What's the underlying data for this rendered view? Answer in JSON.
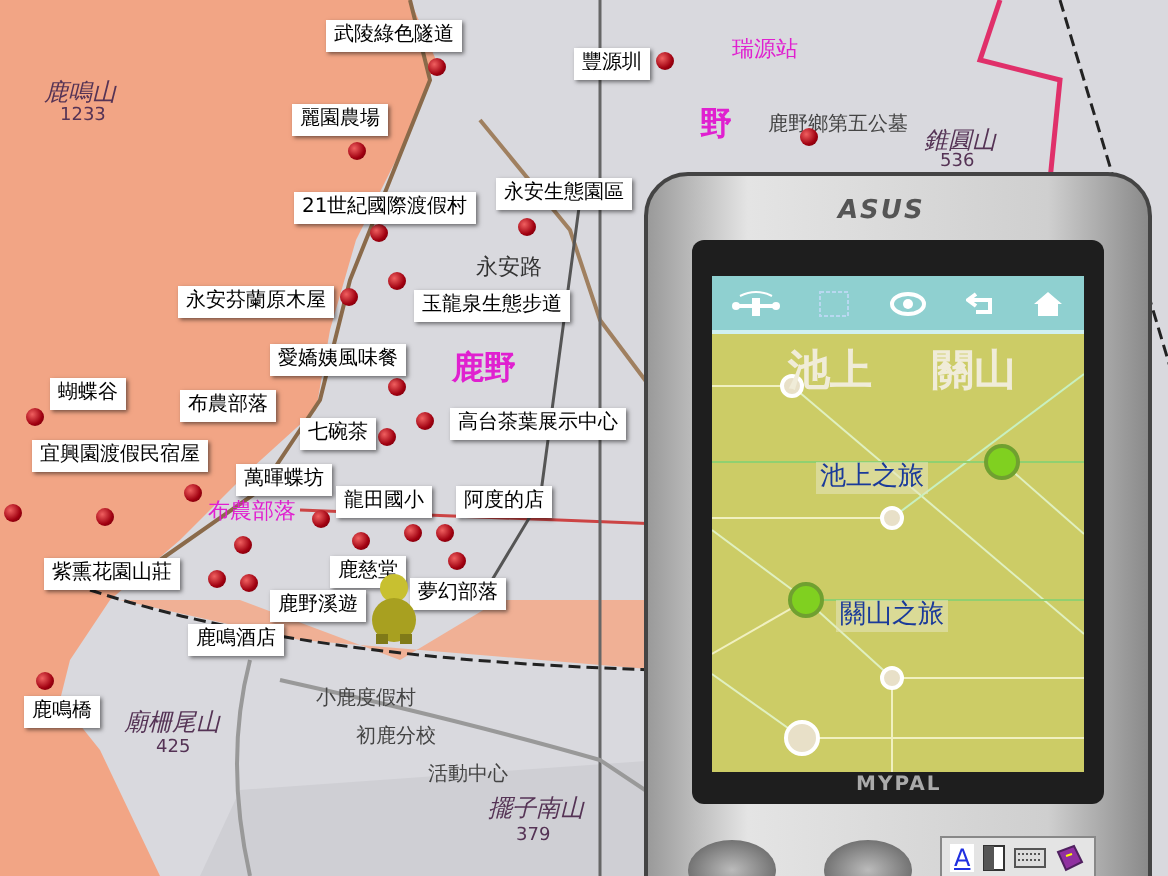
{
  "map": {
    "place_names": [
      {
        "text": "瑞源站",
        "kind": "station"
      },
      {
        "text": "鹿鳴山",
        "kind": "peak"
      },
      {
        "text": "1233",
        "kind": "height"
      },
      {
        "text": "野",
        "kind": "town"
      },
      {
        "text": "鹿野鄉第五公墓",
        "kind": "place"
      },
      {
        "text": "錐圓山",
        "kind": "peak"
      },
      {
        "text": "536",
        "kind": "height"
      },
      {
        "text": "永安路",
        "kind": "road"
      },
      {
        "text": "鹿野",
        "kind": "town"
      },
      {
        "text": "布農部落",
        "kind": "village"
      },
      {
        "text": "小鹿度假村",
        "kind": "place"
      },
      {
        "text": "廟柵尾山",
        "kind": "peak"
      },
      {
        "text": "425",
        "kind": "height"
      },
      {
        "text": "初鹿分校",
        "kind": "place"
      },
      {
        "text": "活動中心",
        "kind": "place"
      },
      {
        "text": "擺子南山",
        "kind": "peak"
      },
      {
        "text": "379",
        "kind": "height"
      }
    ],
    "pins": [
      {
        "label": "武陵綠色隧道"
      },
      {
        "label": "豐源圳"
      },
      {
        "label": "麗園農場"
      },
      {
        "label": "永安生態園區"
      },
      {
        "label": "21世紀國際渡假村"
      },
      {
        "label": "永安芬蘭原木屋"
      },
      {
        "label": "玉龍泉生態步道"
      },
      {
        "label": "愛嬌姨風味餐"
      },
      {
        "label": "蝴蝶谷"
      },
      {
        "label": "布農部落"
      },
      {
        "label": "七碗茶"
      },
      {
        "label": "高台茶葉展示中心"
      },
      {
        "label": "宜興園渡假民宿屋"
      },
      {
        "label": "萬暉蝶坊"
      },
      {
        "label": "龍田國小"
      },
      {
        "label": "阿度的店"
      },
      {
        "label": "紫熏花園山莊"
      },
      {
        "label": "鹿慈堂"
      },
      {
        "label": "夢幻部落"
      },
      {
        "label": "鹿野溪遊"
      },
      {
        "label": "鹿鳴酒店"
      },
      {
        "label": "鹿鳴橋"
      }
    ]
  },
  "device": {
    "brand": "ASUS",
    "model": "MYPAL",
    "screen": {
      "titles": [
        "池上",
        "關山"
      ],
      "routes": [
        {
          "label": "池上之旅"
        },
        {
          "label": "關山之旅"
        }
      ]
    },
    "tray": {
      "input_mode": "A"
    }
  }
}
